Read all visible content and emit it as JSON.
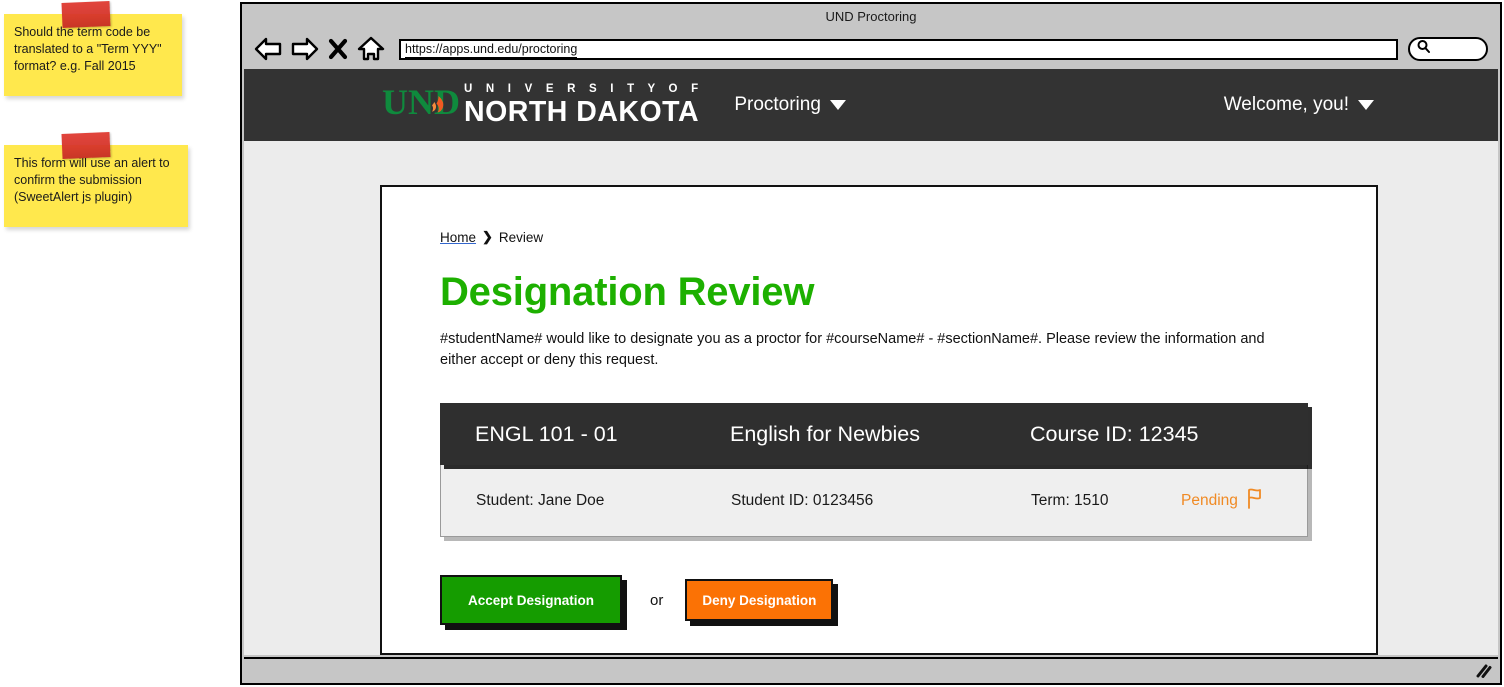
{
  "annotations": [
    {
      "name": "term-code-note",
      "text": "Should the term code be translated to a \"Term YYY\" format? e.g. Fall 2015"
    },
    {
      "name": "alert-note",
      "text": "This form will use an alert to confirm the submission (SweetAlert js plugin)"
    }
  ],
  "browser": {
    "window_title": "UND Proctoring",
    "address": "https://apps.und.edu/proctoring",
    "search_placeholder": "",
    "search_value": "",
    "back_icon": "back-arrow-icon",
    "forward_icon": "forward-arrow-icon",
    "stop_icon": "close-x-icon",
    "home_icon": "home-icon",
    "search_icon": "search-icon",
    "resize_icon": "resize-grip-icon"
  },
  "site_header": {
    "logo_text_line1": "U N I V E R S I T Y   O F",
    "logo_text_line2": "NORTH DAKOTA",
    "logo_mark": "und-logo-icon",
    "logo_green": "#0f8a3d",
    "logo_flame_orange": "#f05a22",
    "nav_label": "Proctoring",
    "user_label": "Welcome, you!",
    "background": "#333333"
  },
  "breadcrumb": {
    "home_label": "Home",
    "separator": "❯",
    "current_label": "Review"
  },
  "page": {
    "title": "Designation Review",
    "title_color": "#1db000",
    "intro": "#studentName# would like to designate you as a proctor for #courseName# - #sectionName#. Please review the information and either accept or deny this request."
  },
  "info_table": {
    "header": {
      "course_code": "ENGL 101 - 01",
      "course_title": "English for Newbies",
      "course_id": "Course ID: 12345"
    },
    "row": {
      "student": "Student: Jane Doe",
      "student_id": "Student ID: 0123456",
      "term": "Term: 1510",
      "status": "Pending",
      "status_color": "#f08a24",
      "status_icon": "flag-icon"
    }
  },
  "actions": {
    "accept_label": "Accept Designation",
    "accept_color": "#159c00",
    "or_label": "or",
    "deny_label": "Deny Designation",
    "deny_color": "#fb7205"
  }
}
